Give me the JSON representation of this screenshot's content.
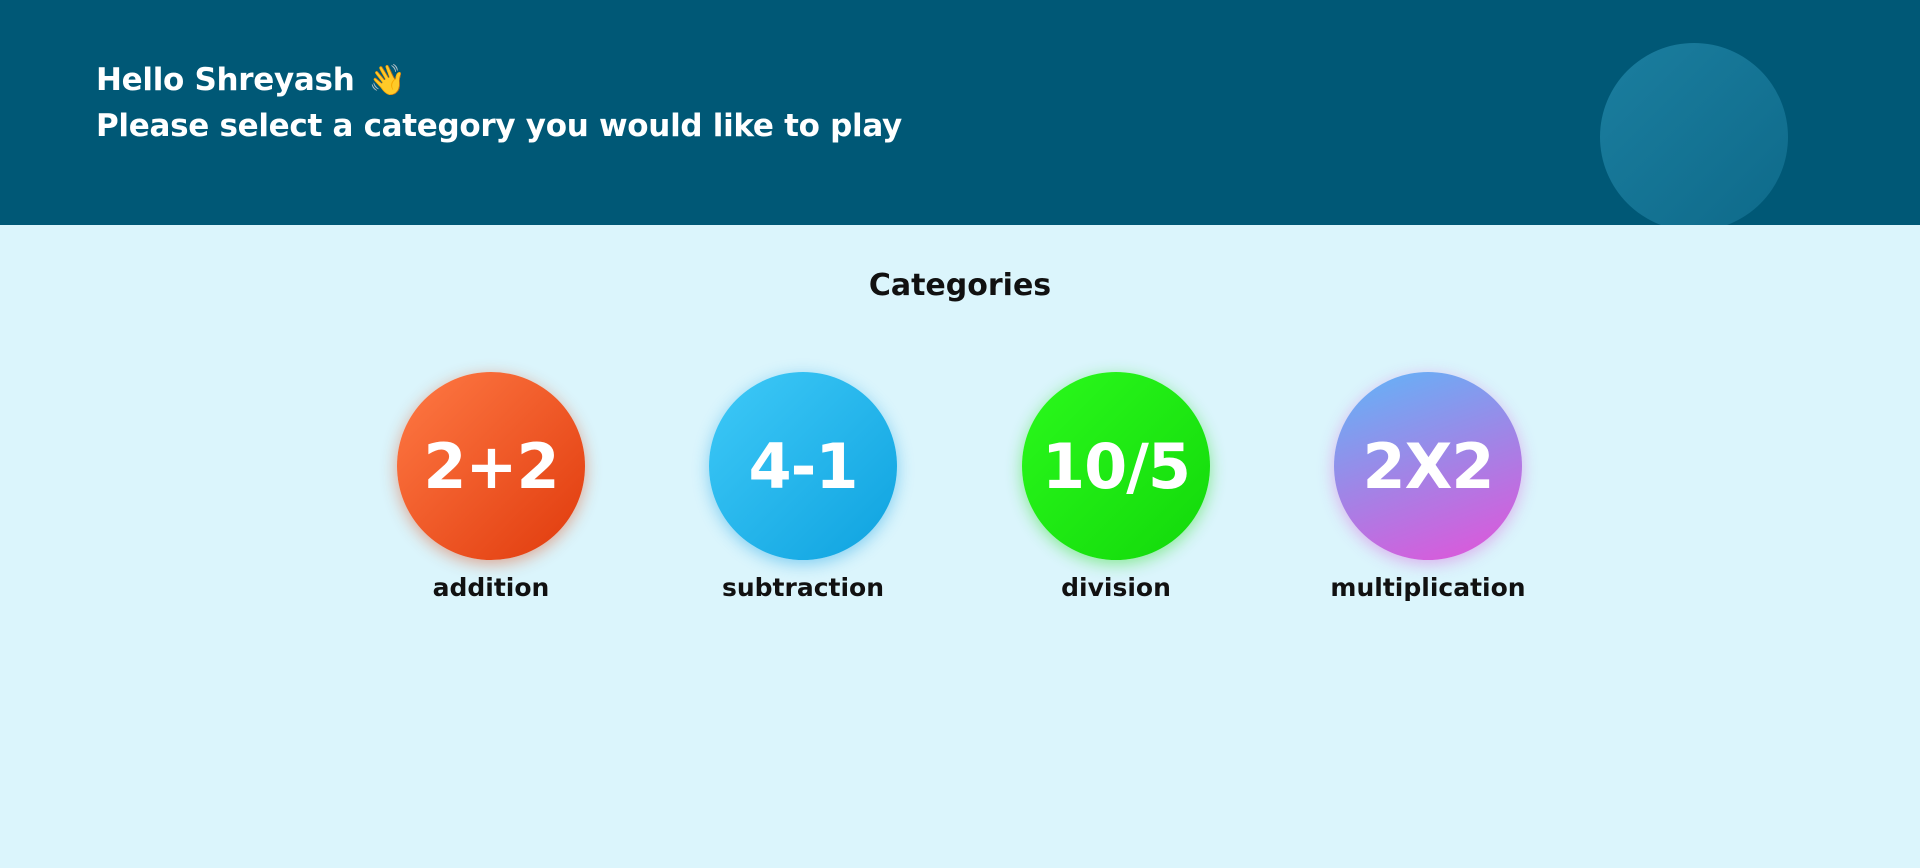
{
  "header": {
    "greeting": "Hello Shreyash",
    "wave_emoji": "👋",
    "subtitle": "Please select a category you would like to play",
    "colors": {
      "background": "#005876",
      "decoration": "#1b7e9f"
    }
  },
  "categories_section": {
    "title": "Categories",
    "background": "#dbf5fc",
    "items": [
      {
        "symbol": "2+2",
        "label": "addition",
        "color_start": "#ff7a45",
        "color_end": "#e03a0c"
      },
      {
        "symbol": "4-1",
        "label": "subtraction",
        "color_start": "#3fcaf8",
        "color_end": "#0ea2df"
      },
      {
        "symbol": "10/5",
        "label": "division",
        "color_start": "#2bfa1c",
        "color_end": "#12d80a"
      },
      {
        "symbol": "2X2",
        "label": "multiplication",
        "color_start": "#5fb6f8",
        "color_end": "#e452d9"
      }
    ]
  }
}
